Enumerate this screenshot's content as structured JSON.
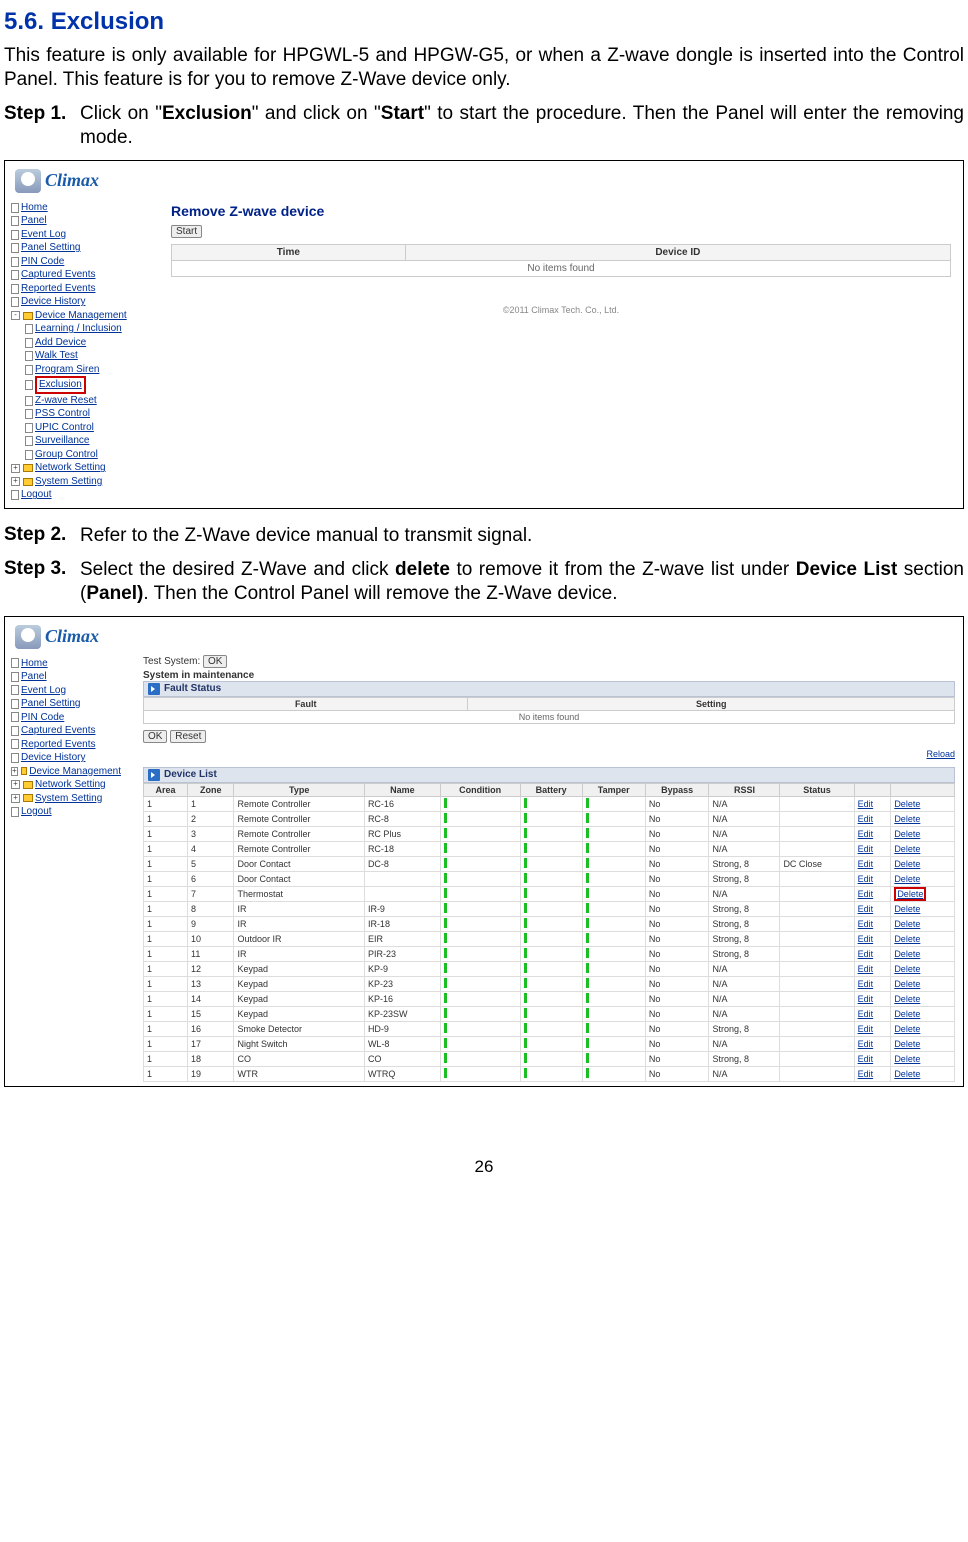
{
  "heading": "5.6. Exclusion",
  "intro": "This feature is only available for HPGWL-5 and HPGW-G5, or when a Z-wave dongle is inserted into the Control Panel. This feature is for you to remove Z-Wave device only.",
  "step1_label": "Step 1.",
  "step1_a": "Click on \"",
  "step1_b": "Exclusion",
  "step1_c": "\" and click on \"",
  "step1_d": "Start",
  "step1_e": "\" to start the procedure. Then the Panel will enter the removing mode.",
  "step2_label": "Step 2.",
  "step2_body": "Refer to the Z-Wave device manual to transmit signal.",
  "step3_label": "Step 3.",
  "step3_a": "Select the desired Z-Wave and click ",
  "step3_b": "delete",
  "step3_c": " to remove it from the Z-wave list under ",
  "step3_d": "Device List",
  "step3_e": " section (",
  "step3_f": "Panel)",
  "step3_g": ". Then the Control Panel will remove the Z-Wave device.",
  "logo_text": "Climax",
  "nav1": {
    "home": "Home",
    "panel": "Panel",
    "event_log": "Event Log",
    "panel_setting": "Panel Setting",
    "pin": "PIN Code",
    "captured": "Captured Events",
    "reported": "Reported Events",
    "history": "Device History",
    "dm": "Device Management",
    "learning": "Learning / Inclusion",
    "add": "Add Device",
    "walk": "Walk Test",
    "siren": "Program Siren",
    "exclusion": "Exclusion",
    "zreset": "Z-wave Reset",
    "pss": "PSS Control",
    "upic": "UPIC Control",
    "surv": "Surveillance",
    "group": "Group Control",
    "network": "Network Setting",
    "system": "System Setting",
    "logout": "Logout"
  },
  "panel1": {
    "title": "Remove Z-wave device",
    "start_btn": "Start",
    "col_time": "Time",
    "col_devid": "Device ID",
    "noitems": "No items found",
    "copyright": "©2011 Climax Tech. Co., Ltd."
  },
  "nav2": {
    "home": "Home",
    "panel": "Panel",
    "event_log": "Event Log",
    "panel_setting": "Panel Setting",
    "pin": "PIN Code",
    "captured": "Captured Events",
    "reported": "Reported Events",
    "history": "Device History",
    "dm": "Device Management",
    "network": "Network Setting",
    "system": "System Setting",
    "logout": "Logout"
  },
  "panel2": {
    "test_label": "Test System:",
    "ok_btn": "OK",
    "maint": "System in maintenance",
    "fault_status": "Fault Status",
    "fault_col": "Fault",
    "setting_col": "Setting",
    "noitems": "No items found",
    "reset_btn": "Reset",
    "device_list": "Device List",
    "reload": "Reload",
    "hdrs": [
      "Area",
      "Zone",
      "Type",
      "Name",
      "Condition",
      "Battery",
      "Tamper",
      "Bypass",
      "RSSI",
      "Status",
      "",
      ""
    ],
    "edit": "Edit",
    "delete": "Delete",
    "rows": [
      {
        "area": "1",
        "zone": "1",
        "type": "Remote Controller",
        "name": "RC-16",
        "bypass": "No",
        "rssi": "N/A",
        "status": ""
      },
      {
        "area": "1",
        "zone": "2",
        "type": "Remote Controller",
        "name": "RC-8",
        "bypass": "No",
        "rssi": "N/A",
        "status": ""
      },
      {
        "area": "1",
        "zone": "3",
        "type": "Remote Controller",
        "name": "RC Plus",
        "bypass": "No",
        "rssi": "N/A",
        "status": ""
      },
      {
        "area": "1",
        "zone": "4",
        "type": "Remote Controller",
        "name": "RC-18",
        "bypass": "No",
        "rssi": "N/A",
        "status": ""
      },
      {
        "area": "1",
        "zone": "5",
        "type": "Door Contact",
        "name": "DC-8",
        "bypass": "No",
        "rssi": "Strong, 8",
        "status": "DC Close"
      },
      {
        "area": "1",
        "zone": "6",
        "type": "Door Contact",
        "name": "",
        "bypass": "No",
        "rssi": "Strong, 8",
        "status": ""
      },
      {
        "area": "1",
        "zone": "7",
        "type": "Thermostat",
        "name": "",
        "bypass": "No",
        "rssi": "N/A",
        "status": ""
      },
      {
        "area": "1",
        "zone": "8",
        "type": "IR",
        "name": "IR-9",
        "bypass": "No",
        "rssi": "Strong, 8",
        "status": ""
      },
      {
        "area": "1",
        "zone": "9",
        "type": "IR",
        "name": "IR-18",
        "bypass": "No",
        "rssi": "Strong, 8",
        "status": ""
      },
      {
        "area": "1",
        "zone": "10",
        "type": "Outdoor IR",
        "name": "EIR",
        "bypass": "No",
        "rssi": "Strong, 8",
        "status": ""
      },
      {
        "area": "1",
        "zone": "11",
        "type": "IR",
        "name": "PIR-23",
        "bypass": "No",
        "rssi": "Strong, 8",
        "status": ""
      },
      {
        "area": "1",
        "zone": "12",
        "type": "Keypad",
        "name": "KP-9",
        "bypass": "No",
        "rssi": "N/A",
        "status": ""
      },
      {
        "area": "1",
        "zone": "13",
        "type": "Keypad",
        "name": "KP-23",
        "bypass": "No",
        "rssi": "N/A",
        "status": ""
      },
      {
        "area": "1",
        "zone": "14",
        "type": "Keypad",
        "name": "KP-16",
        "bypass": "No",
        "rssi": "N/A",
        "status": ""
      },
      {
        "area": "1",
        "zone": "15",
        "type": "Keypad",
        "name": "KP-23SW",
        "bypass": "No",
        "rssi": "N/A",
        "status": ""
      },
      {
        "area": "1",
        "zone": "16",
        "type": "Smoke Detector",
        "name": "HD-9",
        "bypass": "No",
        "rssi": "Strong, 8",
        "status": ""
      },
      {
        "area": "1",
        "zone": "17",
        "type": "Night Switch",
        "name": "WL-8",
        "bypass": "No",
        "rssi": "N/A",
        "status": ""
      },
      {
        "area": "1",
        "zone": "18",
        "type": "CO",
        "name": "CO",
        "bypass": "No",
        "rssi": "Strong, 8",
        "status": ""
      },
      {
        "area": "1",
        "zone": "19",
        "type": "WTR",
        "name": "WTRQ",
        "bypass": "No",
        "rssi": "N/A",
        "status": ""
      }
    ]
  },
  "page_num": "26"
}
